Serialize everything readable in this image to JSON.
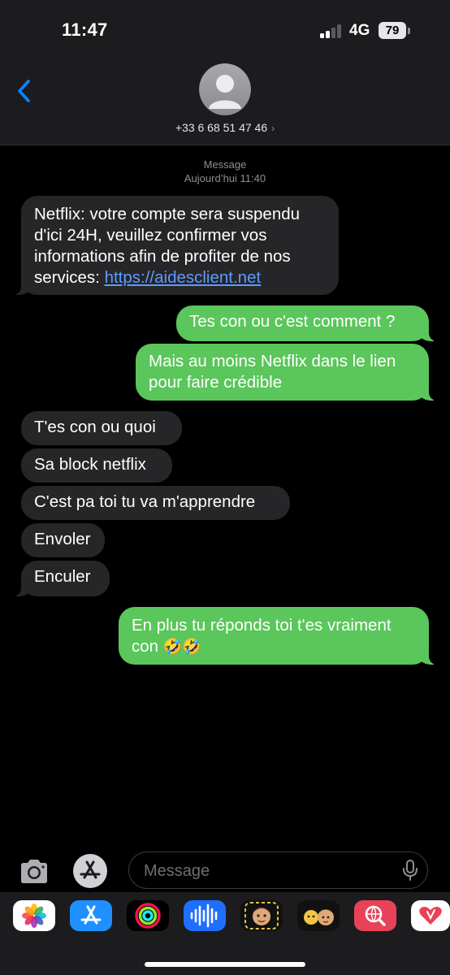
{
  "status_bar": {
    "time": "11:47",
    "network": "4G",
    "battery": "79"
  },
  "header": {
    "contact": "+33 6 68 51 47 46",
    "chevron": "›"
  },
  "thread": {
    "service_label": "Message",
    "timestamp": "Aujourd’hui 11:40",
    "messages": [
      {
        "direction": "incoming",
        "lines": [
          "Netflix: votre compte sera suspendu",
          "d'ici 24H, veuillez confirmer vos",
          "informations afin de profiter de nos"
        ],
        "last_line_prefix": "services: ",
        "link": "https://aidesclient.net"
      },
      {
        "direction": "outgoing",
        "text": "Tes con ou c'est comment ?"
      },
      {
        "direction": "outgoing",
        "lines": [
          "Mais au moins Netflix dans le lien",
          "pour faire crédible"
        ]
      },
      {
        "direction": "incoming",
        "text": "T'es con ou quoi"
      },
      {
        "direction": "incoming",
        "text": "Sa block netflix"
      },
      {
        "direction": "incoming",
        "text": "C'est pa toi tu va m'apprendre"
      },
      {
        "direction": "incoming",
        "text": "Envoler"
      },
      {
        "direction": "incoming",
        "text": "Enculer"
      },
      {
        "direction": "outgoing",
        "lines": [
          "En plus tu réponds toi t'es vraiment",
          "con "
        ],
        "emoji": "🤣🤣"
      }
    ]
  },
  "input_bar": {
    "placeholder": "Message"
  },
  "app_drawer": {
    "apps": [
      "photos-icon",
      "app-store-icon",
      "fitness-icon",
      "audio-message-icon",
      "memoji-stickers-icon",
      "memoji-icon",
      "web-search-icon",
      "digital-touch-icon"
    ]
  },
  "colors": {
    "outgoing_bubble": "#5ac65b",
    "incoming_bubble": "#262628",
    "link": "#5e9bff",
    "accent": "#0a84ff"
  }
}
